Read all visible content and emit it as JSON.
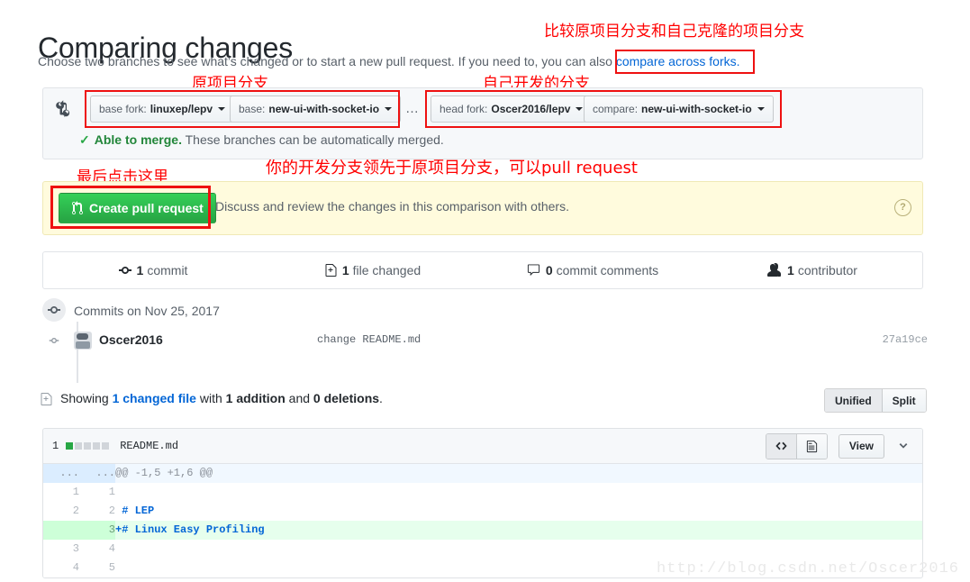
{
  "header": {
    "title": "Comparing changes",
    "subtitle_before": "Choose two branches to see what’s changed or to start a new pull request. If you need to, you can also ",
    "subtitle_link": "compare across forks.",
    "subtitle_after": ""
  },
  "annotations": {
    "top": "比较原项目分支和自己克隆的项目分支",
    "base": "原项目分支",
    "head": "自己开发的分支",
    "click_here": "最后点击这里",
    "ahead": "你的开发分支领先于原项目分支，可以pull request"
  },
  "compare": {
    "icon": "git-compare-icon",
    "base_fork_label": "base fork:",
    "base_fork_value": "linuxep/lepv",
    "base_label": "base:",
    "base_value": "new-ui-with-socket-io",
    "ellipsis": "…",
    "head_fork_label": "head fork:",
    "head_fork_value": "Oscer2016/lepv",
    "compare_label": "compare:",
    "compare_value": "new-ui-with-socket-io",
    "merge_check": "✓",
    "merge_status_bold": "Able to merge.",
    "merge_status_rest": " These branches can be automatically merged."
  },
  "pull_request": {
    "button_label": "Create pull request",
    "button_icon": "git-pull-request-icon",
    "description": "Discuss and review the changes in this comparison with others.",
    "help_icon": "?"
  },
  "stats": [
    {
      "icon": "commit-icon",
      "count": "1",
      "label": "commit"
    },
    {
      "icon": "file-diff-icon",
      "count": "1",
      "label": "file changed"
    },
    {
      "icon": "comment-icon",
      "count": "0",
      "label": "commit comments"
    },
    {
      "icon": "people-icon",
      "count": "1",
      "label": "contributor"
    }
  ],
  "commits": {
    "group_icon": "git-commit-group-icon",
    "group_label": "Commits on Nov 25, 2017",
    "rows": [
      {
        "avatar": "avatar",
        "author": "Oscer2016",
        "message": "change README.md",
        "sha": "27a19ce"
      }
    ]
  },
  "diff_summary": {
    "icon": "file-diff-icon",
    "showing": "Showing ",
    "changed_file_link": "1 changed file",
    "with": " with ",
    "additions": "1 addition",
    "and": " and ",
    "deletions": "0 deletions",
    "period": ".",
    "unified_label": "Unified",
    "split_label": "Split"
  },
  "file": {
    "changes_count": "1",
    "blocks": [
      "add",
      "neutral",
      "neutral",
      "neutral",
      "neutral"
    ],
    "name": "README.md",
    "code_icon": "code-icon",
    "blob_icon": "file-icon",
    "view_label": "View",
    "chevron_icon": "chevron-down-icon",
    "diff_rows": [
      {
        "type": "hunk",
        "old": "...",
        "new": "...",
        "code": "@@ -1,5 +1,6 @@"
      },
      {
        "type": "ctx",
        "old": "1",
        "new": "1",
        "code": " "
      },
      {
        "type": "ctx",
        "old": "2",
        "new": "2",
        "code": " # LEP",
        "md": true
      },
      {
        "type": "add",
        "old": "",
        "new": "3",
        "code": "+# Linux Easy Profiling",
        "md": true
      },
      {
        "type": "ctx",
        "old": "3",
        "new": "4",
        "code": " "
      },
      {
        "type": "ctx",
        "old": "4",
        "new": "5",
        "code": " "
      }
    ]
  },
  "watermark": "http://blog.csdn.net/Oscer2016"
}
